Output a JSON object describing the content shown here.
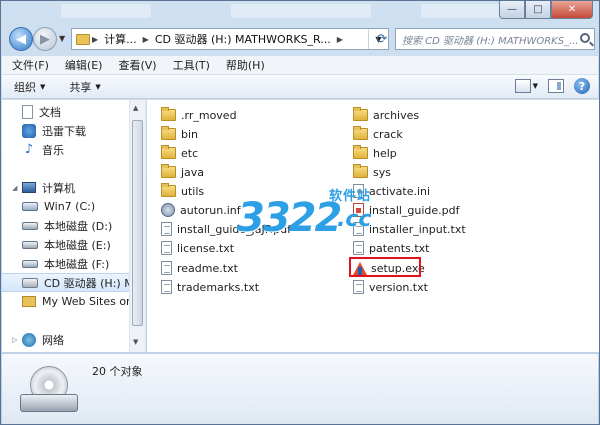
{
  "titlebar": {
    "minimize": "—",
    "maximize": "□",
    "close": "✕"
  },
  "address": {
    "crumbs": [
      "计算...",
      "CD 驱动器 (H:) MATHWORKS_R..."
    ],
    "search_placeholder": "搜索 CD 驱动器 (H:) MATHWORKS_..."
  },
  "menubar": {
    "items": [
      "文件(F)",
      "编辑(E)",
      "查看(V)",
      "工具(T)",
      "帮助(H)"
    ]
  },
  "toolbar": {
    "organize": "组织",
    "share": "共享",
    "help": "?"
  },
  "navpane": {
    "items": [
      {
        "label": "文档",
        "icon": "document-icon"
      },
      {
        "label": "迅雷下载",
        "icon": "xunlei-icon"
      },
      {
        "label": "音乐",
        "icon": "music-icon"
      },
      {
        "label": "计算机",
        "icon": "computer-icon"
      },
      {
        "label": "Win7 (C:)",
        "icon": "system-drive-icon"
      },
      {
        "label": "本地磁盘 (D:)",
        "icon": "drive-icon"
      },
      {
        "label": "本地磁盘 (E:)",
        "icon": "drive-icon"
      },
      {
        "label": "本地磁盘 (F:)",
        "icon": "drive-icon"
      },
      {
        "label": "CD 驱动器 (H:) M",
        "icon": "cd-drive-icon"
      },
      {
        "label": "My Web Sites or",
        "icon": "web-sites-icon"
      },
      {
        "label": "网络",
        "icon": "network-icon"
      }
    ]
  },
  "files": {
    "left": [
      {
        "name": ".rr_moved",
        "type": "folder"
      },
      {
        "name": "bin",
        "type": "folder"
      },
      {
        "name": "etc",
        "type": "folder"
      },
      {
        "name": "java",
        "type": "folder"
      },
      {
        "name": "utils",
        "type": "folder"
      },
      {
        "name": "autorun.inf",
        "type": "autorun"
      },
      {
        "name": "install_guide_jaJP.pdf",
        "type": "pdf"
      },
      {
        "name": "license.txt",
        "type": "txt"
      },
      {
        "name": "readme.txt",
        "type": "txt"
      },
      {
        "name": "trademarks.txt",
        "type": "txt"
      }
    ],
    "right": [
      {
        "name": "archives",
        "type": "folder"
      },
      {
        "name": "crack",
        "type": "folder"
      },
      {
        "name": "help",
        "type": "folder"
      },
      {
        "name": "sys",
        "type": "folder"
      },
      {
        "name": "activate.ini",
        "type": "ini"
      },
      {
        "name": "install_guide.pdf",
        "type": "pdf"
      },
      {
        "name": "installer_input.txt",
        "type": "txt"
      },
      {
        "name": "patents.txt",
        "type": "txt"
      },
      {
        "name": "setup.exe",
        "type": "exe"
      },
      {
        "name": "version.txt",
        "type": "txt"
      }
    ]
  },
  "watermark": {
    "number": "3322",
    "suffix": ".cc",
    "label": "软件站"
  },
  "details": {
    "count": "20 个对象"
  },
  "colors": {
    "highlight_box": "#e3111b",
    "watermark": "#2d9fe4"
  }
}
